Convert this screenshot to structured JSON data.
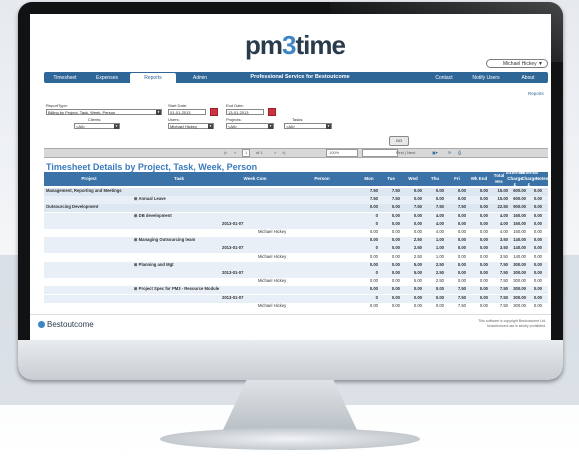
{
  "app": {
    "logo_prefix": "pm",
    "logo_digit": "3",
    "logo_suffix": "time"
  },
  "user": {
    "name": "Michael Hickey"
  },
  "nav": {
    "left_tabs": [
      "Timesheet",
      "Expenses",
      "Reports",
      "Admin"
    ],
    "active_tab": "Reports",
    "center_title": "Professional Service for Bestoutcome",
    "right_tabs": [
      "Contact",
      "Notify Users",
      "About"
    ]
  },
  "reports_link": "Reports",
  "filters": {
    "report_type_label": "ReportType:",
    "report_type_value": "Billing by Project, Task, Week, Person",
    "start_date_label": "Start Date:",
    "start_date_value": "01-01-2013",
    "end_date_label": "End Date:",
    "end_date_value": "13-01-2013",
    "clients_label": "Clients:",
    "clients_value": "<All>",
    "users_label": "Users:",
    "users_value": "Michael Hickey",
    "projects_label": "Projects:",
    "projects_value": "<All>",
    "tasks_label": "Tasks:",
    "tasks_value": "<All>",
    "go_label": "GO"
  },
  "pager": {
    "first": "|<",
    "prev": "<",
    "page": "1",
    "of_label": "of 1",
    "next": ">",
    "last": ">|",
    "zoom": "100%",
    "find_label": "Find | Next"
  },
  "report": {
    "title": "Timesheet Details by Project, Task, Week, Person"
  },
  "table": {
    "headers": [
      "Project",
      "Task",
      "Week Com",
      "Person",
      "Mon",
      "Tue",
      "Wed",
      "Thu",
      "Fri",
      "Wk End",
      "Total Hrs",
      "External Charge £",
      "External Charge £",
      "Notes"
    ],
    "rows": [
      {
        "project": "Management, Reporting and Meetings",
        "task": "",
        "week": "",
        "person": "",
        "vals": [
          "7.50",
          "7.50",
          "0.00",
          "0.00",
          "0.00",
          "0.00",
          "15.00",
          "600.00",
          "0.00"
        ],
        "bold": true
      },
      {
        "project": "",
        "task": "⊞ Annual Leave",
        "week": "",
        "person": "",
        "vals": [
          "7.50",
          "7.50",
          "0.00",
          "0.00",
          "0.00",
          "0.00",
          "15.00",
          "600.00",
          "0.00"
        ],
        "bold": true
      },
      {
        "project": "Outsourcing Development",
        "task": "",
        "week": "",
        "person": "",
        "vals": [
          "0.00",
          "0.00",
          "7.50",
          "7.50",
          "7.50",
          "0.00",
          "22.50",
          "900.00",
          "0.00"
        ],
        "bold": true
      },
      {
        "project": "",
        "task": "⊞ DB development",
        "week": "",
        "person": "",
        "vals": [
          "0",
          "0.00",
          "0.00",
          "4.00",
          "0.00",
          "0.00",
          "4.00",
          "160.00",
          "0.00"
        ],
        "bold": true
      },
      {
        "project": "",
        "task": "",
        "week": "2013-01-07",
        "person": "",
        "vals": [
          "0",
          "0.00",
          "0.00",
          "4.00",
          "0.00",
          "0.00",
          "4.00",
          "160.00",
          "0.00"
        ],
        "bold": true
      },
      {
        "project": "",
        "task": "",
        "week": "",
        "person": "Michael Hickey",
        "vals": [
          "0.00",
          "0.00",
          "0.00",
          "4.00",
          "0.00",
          "0.00",
          "4.00",
          "160.00",
          "0.00"
        ],
        "bold": false
      },
      {
        "project": "",
        "task": "⊞ Managing Outsourcing team",
        "week": "",
        "person": "",
        "vals": [
          "0.00",
          "0.00",
          "2.50",
          "1.00",
          "0.00",
          "0.00",
          "3.50",
          "140.00",
          "0.00"
        ],
        "bold": true
      },
      {
        "project": "",
        "task": "",
        "week": "2013-01-07",
        "person": "",
        "vals": [
          "0",
          "0.00",
          "2.50",
          "1.00",
          "0.00",
          "0.00",
          "3.50",
          "140.00",
          "0.00"
        ],
        "bold": true
      },
      {
        "project": "",
        "task": "",
        "week": "",
        "person": "Michael Hickey",
        "vals": [
          "0.00",
          "0.00",
          "2.50",
          "1.00",
          "0.00",
          "0.00",
          "3.50",
          "140.00",
          "0.00"
        ],
        "bold": false
      },
      {
        "project": "",
        "task": "⊞ Planning and Mgt",
        "week": "",
        "person": "",
        "vals": [
          "0.00",
          "0.00",
          "5.00",
          "2.50",
          "0.00",
          "0.00",
          "7.50",
          "300.00",
          "0.00"
        ],
        "bold": true
      },
      {
        "project": "",
        "task": "",
        "week": "2013-01-07",
        "person": "",
        "vals": [
          "0",
          "0.00",
          "5.00",
          "2.50",
          "0.00",
          "0.00",
          "7.50",
          "300.00",
          "0.00"
        ],
        "bold": true
      },
      {
        "project": "",
        "task": "",
        "week": "",
        "person": "Michael Hickey",
        "vals": [
          "0.00",
          "0.00",
          "5.00",
          "2.50",
          "0.00",
          "0.00",
          "7.50",
          "300.00",
          "0.00"
        ],
        "bold": false
      },
      {
        "project": "",
        "task": "⊞ Project Spec for PM3 - Resource Module",
        "week": "",
        "person": "",
        "vals": [
          "0.00",
          "0.00",
          "0.00",
          "0.00",
          "7.50",
          "0.00",
          "7.50",
          "300.00",
          "0.00"
        ],
        "bold": true
      },
      {
        "project": "",
        "task": "",
        "week": "2013-01-07",
        "person": "",
        "vals": [
          "0",
          "0.00",
          "0.00",
          "0.00",
          "7.50",
          "0.00",
          "7.50",
          "300.00",
          "0.00"
        ],
        "bold": true
      },
      {
        "project": "",
        "task": "",
        "week": "",
        "person": "Michael Hickey",
        "vals": [
          "0.00",
          "0.00",
          "0.00",
          "0.00",
          "7.50",
          "0.00",
          "7.50",
          "300.00",
          "0.00"
        ],
        "bold": false
      }
    ]
  },
  "footer": {
    "brand": "Bestoutcome",
    "copyright_line1": "This software is copyright Bestoutcome Ltd.",
    "copyright_line2": "Unauthorized use is strictly prohibited."
  },
  "colors": {
    "nav": "#2f6698",
    "header": "#3b73a8",
    "title": "#3a7bbd",
    "row_tint": "#e8eff7"
  }
}
